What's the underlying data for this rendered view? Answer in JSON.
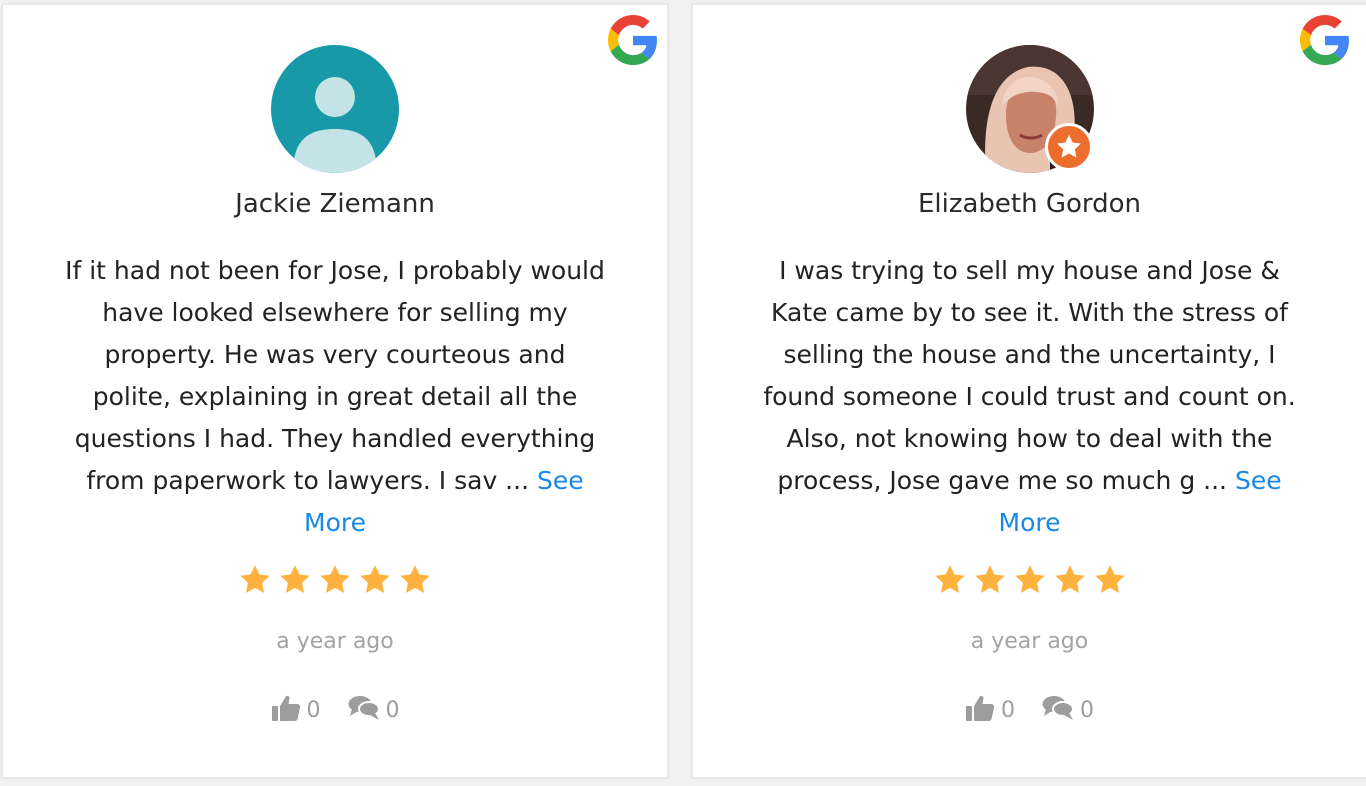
{
  "colors": {
    "link": "#1a88e8",
    "star": "#ffb13d",
    "muted": "#a3a3a3",
    "avatar_default_bg": "#1899a7",
    "badge": "#ec6e2d"
  },
  "reviews": [
    {
      "source_icon": "google-icon",
      "avatar_icon": "default-user-icon",
      "name": "Jackie Ziemann",
      "text": "If it had not been for Jose, I probably would have looked elsewhere for selling my property. He was very courteous and polite, explaining in great detail all the questions I had. They handled everything from paperwork to lawyers. I sav ... ",
      "see_more": "See More",
      "rating": 5,
      "time": "a year ago",
      "likes": "0",
      "comments": "0"
    },
    {
      "source_icon": "google-icon",
      "avatar_icon": "profile-photo",
      "badge_icon": "local-guide-badge-icon",
      "name": "Elizabeth Gordon",
      "text": "I was trying to sell my house and Jose & Kate came by to see it. With the stress of selling the house and the uncertainty, I found someone I could trust and count on. Also, not knowing how to deal with the process, Jose gave me so much g ... ",
      "see_more": "See More",
      "rating": 5,
      "time": "a year ago",
      "likes": "0",
      "comments": "0"
    }
  ]
}
